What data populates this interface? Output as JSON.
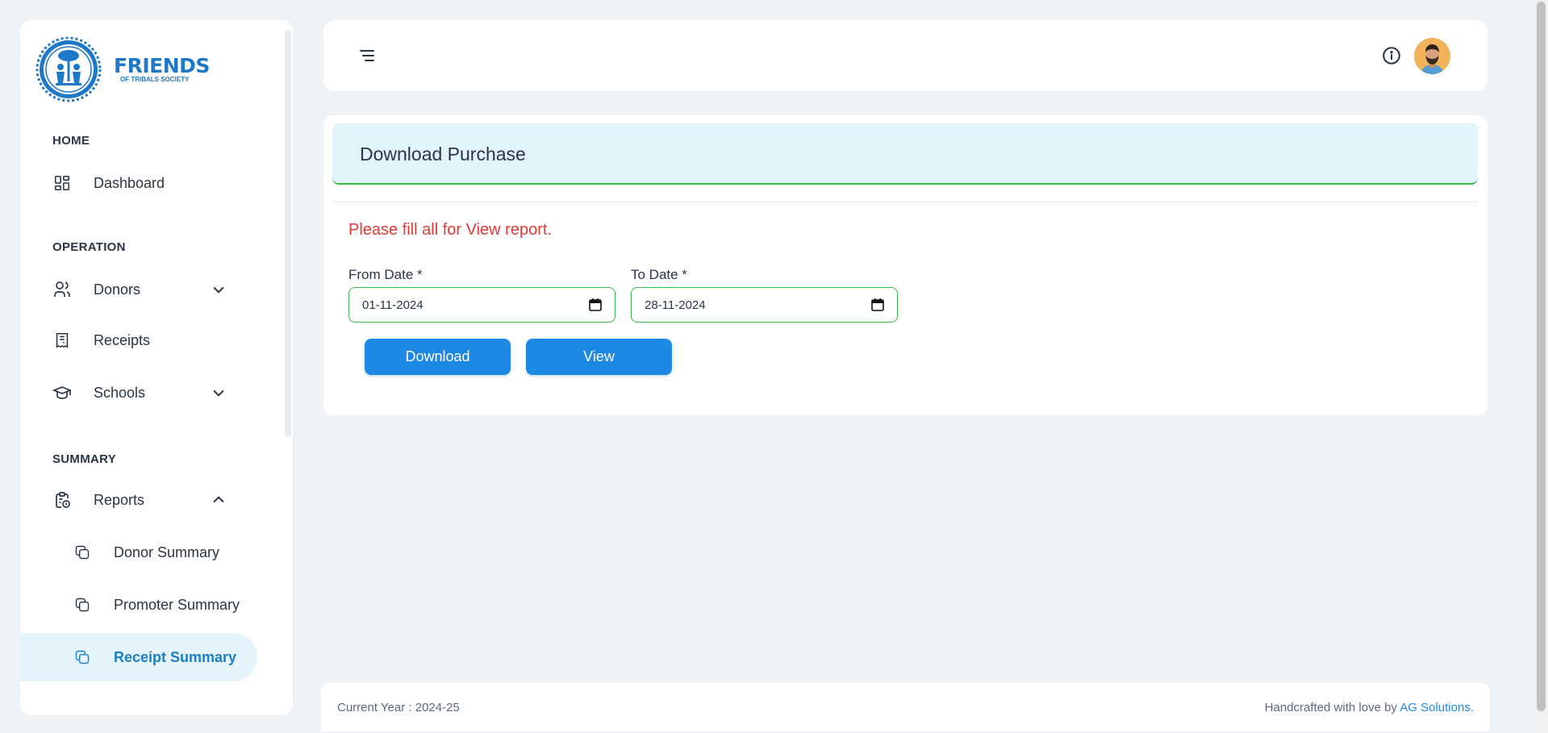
{
  "brand": {
    "name": "FRIENDS",
    "tagline": "OF TRIBALS SOCIETY",
    "accent": "#1e78c8"
  },
  "sidebar": {
    "sections": [
      {
        "title": "HOME"
      },
      {
        "title": "OPERATION"
      },
      {
        "title": "SUMMARY"
      }
    ],
    "items": [
      {
        "label": "Dashboard",
        "icon": "dashboard-icon"
      },
      {
        "label": "Donors",
        "icon": "users-icon",
        "expandable": true,
        "expanded": false
      },
      {
        "label": "Receipts",
        "icon": "receipt-icon"
      },
      {
        "label": "Schools",
        "icon": "graduation-cap-icon",
        "expandable": true,
        "expanded": false
      },
      {
        "label": "Reports",
        "icon": "clipboard-clock-icon",
        "expandable": true,
        "expanded": true
      }
    ],
    "sub_items": [
      {
        "label": "Donor Summary",
        "icon": "copy-icon",
        "active": false
      },
      {
        "label": "Promoter Summary",
        "icon": "copy-icon",
        "active": false
      },
      {
        "label": "Receipt Summary",
        "icon": "copy-icon",
        "active": true
      }
    ]
  },
  "header": {
    "menu_icon": "menu-icon",
    "info_icon": "info-icon",
    "avatar_icon": "avatar"
  },
  "page": {
    "title": "Download Purchase",
    "warning": "Please fill all for View report.",
    "from_label": "From Date *",
    "from_value": "01-11-2024",
    "to_label": "To Date *",
    "to_value": "28-11-2024",
    "download_label": "Download",
    "view_label": "View",
    "colors": {
      "header_bg": "#e1f4fb",
      "success_border": "#3ab54a",
      "warning": "#e53935",
      "primary": "#1e88e5"
    }
  },
  "footer": {
    "current_year": "Current Year : 2024-25",
    "credit_prefix": "Handcrafted with love by",
    "credit_link": "AG Solutions."
  }
}
